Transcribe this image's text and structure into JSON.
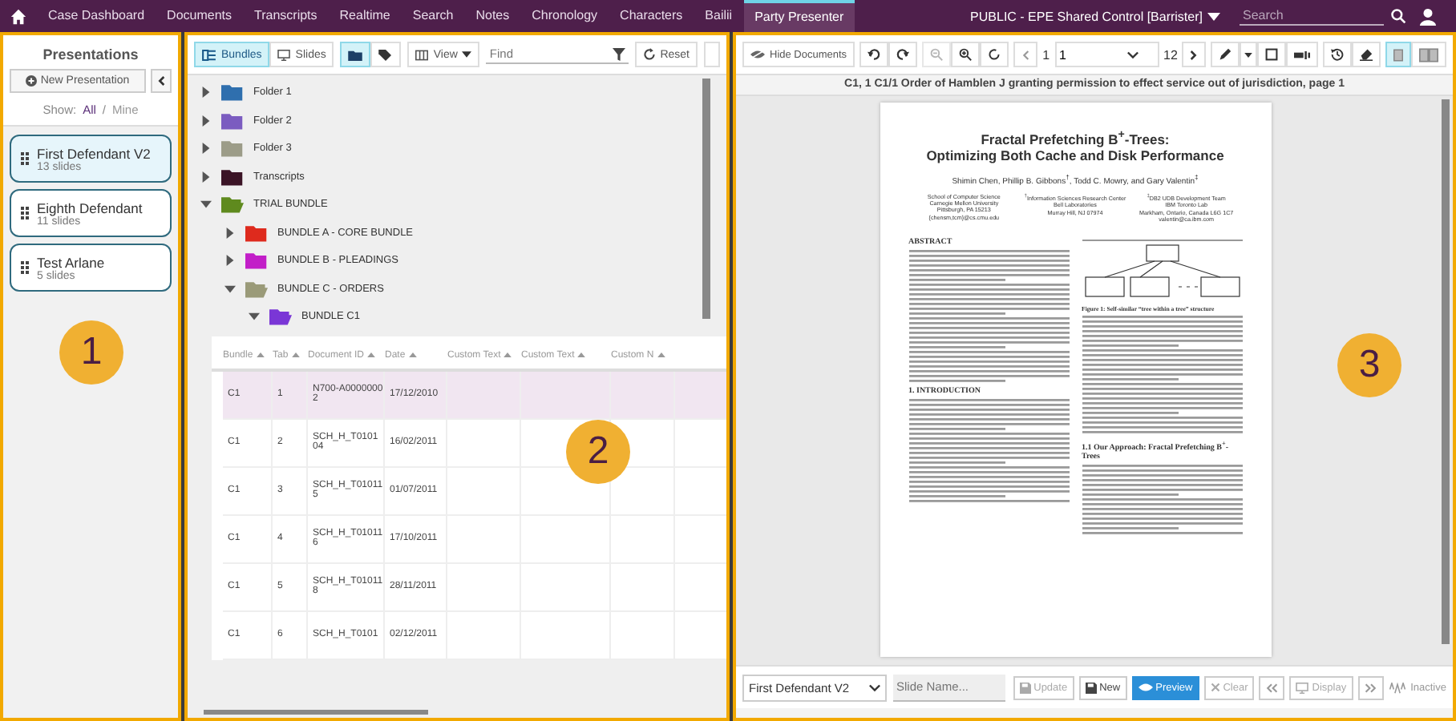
{
  "nav": {
    "items": [
      {
        "label": "Case Dashboard",
        "selected": false
      },
      {
        "label": "Documents",
        "selected": false
      },
      {
        "label": "Transcripts",
        "selected": false
      },
      {
        "label": "Realtime",
        "selected": false
      },
      {
        "label": "Search",
        "selected": false
      },
      {
        "label": "Notes",
        "selected": false
      },
      {
        "label": "Chronology",
        "selected": false
      },
      {
        "label": "Characters",
        "selected": false
      },
      {
        "label": "Bailii",
        "selected": false
      },
      {
        "label": "Party Presenter",
        "selected": true
      }
    ],
    "account": "PUBLIC - EPE Shared Control [Barrister]",
    "search_placeholder": "Search"
  },
  "presentations_panel": {
    "title": "Presentations",
    "new_button": "New Presentation",
    "show_label": "Show:",
    "separator": "/",
    "filters": [
      {
        "label": "All",
        "selected": true
      },
      {
        "label": "Mine",
        "selected": false
      }
    ],
    "items": [
      {
        "name": "First Defendant V2",
        "count": "13 slides",
        "selected": true
      },
      {
        "name": "Eighth Defendant",
        "count": "11 slides",
        "selected": false
      },
      {
        "name": "Test Arlane",
        "count": "5 slides",
        "selected": false
      }
    ]
  },
  "documents_panel": {
    "modes": [
      {
        "label": "Bundles",
        "selected": true
      },
      {
        "label": "Slides",
        "selected": false
      }
    ],
    "view_toggle": [
      {
        "selected": true
      },
      {
        "selected": false
      }
    ],
    "view_button": "View",
    "find_placeholder": "Find",
    "reset_button": "Reset",
    "tree": [
      {
        "label": "Folder 1",
        "color": "#2f6fae",
        "expanded": false
      },
      {
        "label": "Folder 2",
        "color": "#7b5cc0",
        "expanded": false
      },
      {
        "label": "Folder 3",
        "color": "#9c9c88",
        "expanded": false
      },
      {
        "label": "Transcripts",
        "color": "#3b1426",
        "expanded": false
      },
      {
        "label": "TRIAL BUNDLE",
        "color": "#5f8a1e",
        "expanded": true,
        "children": [
          {
            "label": "BUNDLE A - CORE BUNDLE",
            "color": "#de2a1d",
            "expanded": false
          },
          {
            "label": "BUNDLE B - PLEADINGS",
            "color": "#c21ec8",
            "expanded": false
          },
          {
            "label": "BUNDLE C - ORDERS",
            "color": "#9a9a78",
            "expanded": true,
            "children": [
              {
                "label": "BUNDLE C1",
                "color": "#7a36d6",
                "expanded": true
              }
            ]
          }
        ]
      }
    ],
    "table": {
      "columns": [
        "Bundle",
        "Tab",
        "Document ID",
        "Date",
        "Custom Text",
        "Custom Text",
        "Custom N"
      ],
      "rows": [
        {
          "cells": [
            "C1",
            "1",
            "N700-A00000002",
            "17/12/2010"
          ],
          "selected": true
        },
        {
          "cells": [
            "C1",
            "2",
            "SCH_H_T010104",
            "16/02/2011"
          ],
          "selected": false
        },
        {
          "cells": [
            "C1",
            "3",
            "SCH_H_T010115",
            "01/07/2011"
          ],
          "selected": false
        },
        {
          "cells": [
            "C1",
            "4",
            "SCH_H_T010116",
            "17/10/2011"
          ],
          "selected": false
        },
        {
          "cells": [
            "C1",
            "5",
            "SCH_H_T010118",
            "28/11/2011"
          ],
          "selected": false
        },
        {
          "cells": [
            "C1",
            "6",
            "SCH_H_T0101",
            "02/12/2011"
          ],
          "selected": false
        }
      ]
    }
  },
  "viewer": {
    "hide_button": "Hide Documents",
    "page_label": "1",
    "page_input": "1",
    "page_count": "12",
    "layout": [
      {
        "selected": true
      },
      {
        "selected": false
      }
    ],
    "caption": "C1, 1 C1/1 Order of Hamblen J granting permission to effect service out of jurisdiction, page 1",
    "document": {
      "title_lines": [
        "Fractal Prefetching B$^{+}$-Trees:",
        "Optimizing Both Cache and Disk Performance"
      ],
      "authors": "Shimin Chen, Phillip B. Gibbons$^{†}$, Todd C. Mowry, and Gary Valentin$^{‡}$",
      "affiliations": [
        [
          "School of Computer Science",
          "Carnegie Mellon University",
          "Pittsburgh, PA 15213",
          "{chensm,tcm}@cs.cmu.edu"
        ],
        [
          "$^{†}$Information Sciences Research Center",
          "Bell Laboratories",
          "Murray Hill, NJ 07974"
        ],
        [
          "$^{‡}$DB2 UDB Development Team",
          "IBM Toronto Lab",
          "Markham, Ontario, Canada L6G 1C7",
          "valentin@ca.ibm.com"
        ]
      ],
      "abstract_heading": "ABSTRACT",
      "intro_heading": "1. INTRODUCTION",
      "figure_caption": "Figure 1: Self-similar “tree within a tree” structure",
      "approach_heading": "1.1 Our Approach: Fractal Prefetching B$^{+}$-Trees"
    }
  },
  "bottom_bar": {
    "presentation": "First Defendant V2",
    "slide_name_placeholder": "Slide Name...",
    "update": {
      "label": "Update",
      "disabled": true
    },
    "new": {
      "label": "New",
      "disabled": false
    },
    "preview": {
      "label": "Preview",
      "disabled": false
    },
    "clear": {
      "label": "Clear",
      "disabled": true
    },
    "display": {
      "label": "Display",
      "disabled": true
    },
    "status": "Inactive"
  },
  "annotations": [
    "1",
    "2",
    "3"
  ]
}
